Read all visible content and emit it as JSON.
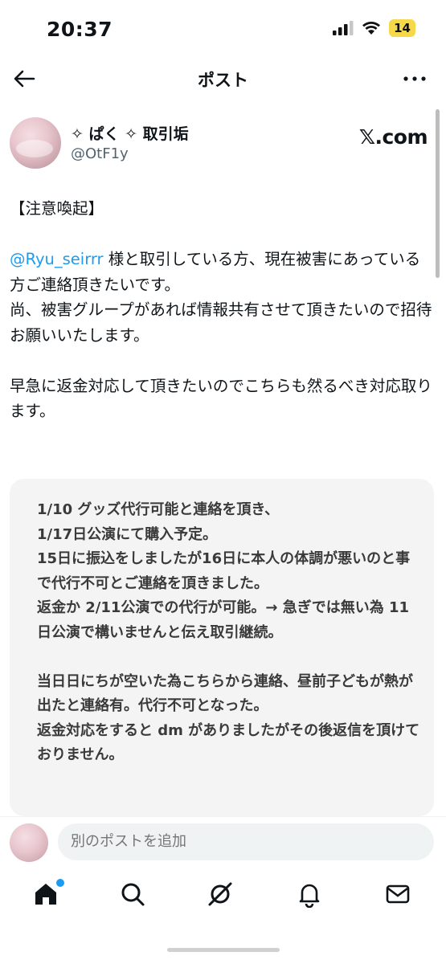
{
  "status": {
    "time": "20:37",
    "battery": "14"
  },
  "nav": {
    "title": "ポスト"
  },
  "author": {
    "name": "✧ ぱく ✧ 取引垢",
    "handle": "@OtF1y",
    "brand": "𝕏.com"
  },
  "post": {
    "heading": "【注意喚起】",
    "mention": "@Ryu_seirrr",
    "body_after_mention": " 様と取引している方、現在被害にあっている方ご連絡頂きたいです。\n尚、被害グループがあれば情報共有させて頂きたいので招待お願いいたします。\n\n早急に返金対応して頂きたいのでこちらも然るべき対応取ります。"
  },
  "quote": {
    "text": "1/10 グッズ代行可能と連絡を頂き、\n1/17日公演にて購入予定。\n15日に振込をしましたが16日に本人の体調が悪いのと事で代行不可とご連絡を頂きました。\n返金か 2/11公演での代行が可能。→ 急ぎでは無い為 11日公演で構いませんと伝え取引継続。\n\n当日日にちが空いた為こちらから連絡、昼前子どもが熱が出たと連絡有。代行不可となった。\n返金対応をすると dm がありましたがその後返信を頂けておりません。"
  },
  "reply": {
    "placeholder": "別のポストを追加"
  },
  "tabs": [
    {
      "icon": "home-icon"
    },
    {
      "icon": "search-icon"
    },
    {
      "icon": "grok-icon"
    },
    {
      "icon": "bell-icon"
    },
    {
      "icon": "mail-icon"
    }
  ],
  "colors": {
    "accent": "#1d9bf0",
    "text": "#0f1419",
    "muted": "#536471",
    "battery": "#f6d94a"
  }
}
